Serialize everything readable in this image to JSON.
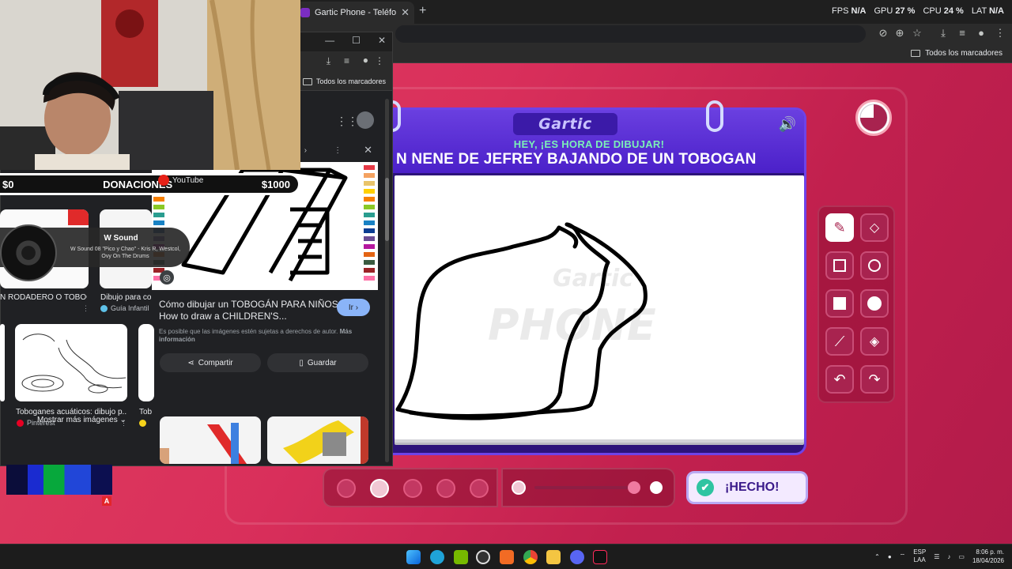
{
  "browser": {
    "tab_title": "Gartic Phone - Teléfono Descon",
    "perf": {
      "fps_label": "FPS",
      "fps_value": "N/A",
      "gpu_label": "GPU",
      "gpu_value": "27 %",
      "cpu_label": "CPU",
      "cpu_value": "24 %",
      "lat_label": "LAT",
      "lat_value": "N/A"
    },
    "bookmarks_label": "Todos los marcadores"
  },
  "game": {
    "logo": "Gartic",
    "hey_text": "HEY, ¡ES HORA DE DIBUJAR!",
    "prompt": "N NENE DE JEFREY BAJANDO DE UN TOBOGAN",
    "watermark_top": "Gartic",
    "watermark_bottom": "PHONE",
    "done_label": "¡HECHO!",
    "timer_fraction_elapsed": 0.75
  },
  "search_window": {
    "bookmarks_label": "Todos los marcadores",
    "youtube_label": "YouTube",
    "results": [
      {
        "title": "N RODADERO O TOBOG...",
        "source": ""
      },
      {
        "title": "Dibujo para col",
        "source": "Guía Infantil"
      },
      {
        "title": "Toboganes acuáticos: dibujo p...",
        "source": "Pinterest"
      },
      {
        "title": "Tob",
        "source": ""
      }
    ],
    "preview": {
      "title": "Cómo dibujar un TOBOGÁN PARA NIÑOS / How to draw a CHILDREN'S...",
      "visit_label": "Ir",
      "note": "Es posible que las imágenes estén sujetas a derechos de autor.",
      "note_link": "Más información",
      "share_label": "Compartir",
      "save_label": "Guardar"
    },
    "more_images_label": "Mostrar más imágenes"
  },
  "overlay": {
    "donations_min": "$0",
    "donations_title": "DONACIONES",
    "donations_max": "$1000",
    "now_playing_title": "W Sound",
    "now_playing_sub": "W Sound 08 \"Pico y Chao\" - Kris R, Westcol, Ovy On The Drums",
    "badge": "A"
  },
  "taskbar": {
    "lang_top": "ESP",
    "lang_bottom": "LAA",
    "time": "8:06 p. m.",
    "date": "18/04/2026"
  },
  "colors": {
    "page_bg": "#d92f5b",
    "card": "#2d137a",
    "hey_green": "#7cf0b7",
    "done_bg": "#f3eaff"
  }
}
